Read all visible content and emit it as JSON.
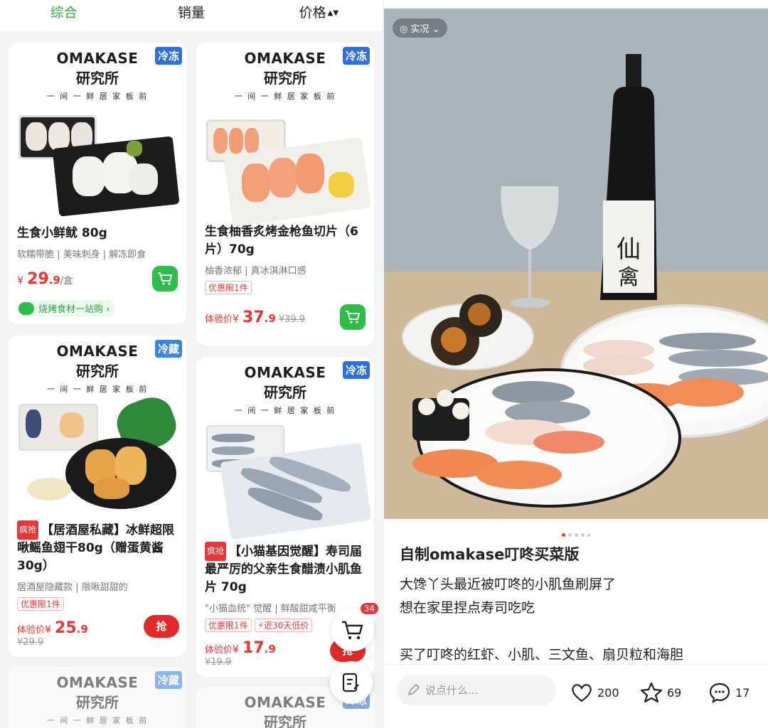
{
  "sort_bar": {
    "tabs": [
      "综合",
      "销量",
      "价格"
    ],
    "sort_icon": "sort-updown-icon"
  },
  "products": [
    {
      "brand_en": "OMAKASE",
      "brand_cn": "研究所",
      "brand_sub": "一 间 一 鲜   居 家 板 前",
      "temp_badge": "冷冻",
      "title": "生食小鲜鱿 80g",
      "desc": "软糯带脆 | 美味刺身 | 解冻即食",
      "price_cur": "¥",
      "price_int": "29",
      "price_dec": ".9",
      "price_unit": "/盒",
      "promo": "烧烤食材一站购 ›"
    },
    {
      "brand_en": "OMAKASE",
      "brand_cn": "研究所",
      "brand_sub": "一 间 一 鲜   居 家 板 前",
      "temp_badge": "冷冻",
      "title": "生食柚香炙烤金枪鱼切片（6片）70g",
      "desc": "柚香浓郁 | 真冰淇淋口感",
      "limit": "优惠限1件",
      "price_label": "体验价",
      "price_cur": "¥",
      "price_int": "37",
      "price_dec": ".9",
      "price_old": "¥39.9"
    },
    {
      "brand_en": "OMAKASE",
      "brand_cn": "研究所",
      "brand_sub": "一 间 一 鲜   居 家 板 前",
      "temp_badge": "冷藏",
      "hot": "疯抢",
      "title": "【居酒屋私藏】冰鲜超限啾鳐鱼翅干80g（赠蛋黄酱30g）",
      "desc": "居酒屋隐藏款 | 限啾甜甜的",
      "limit": "优惠限1件",
      "price_label": "体验价",
      "price_cur": "¥",
      "price_int": "25",
      "price_dec": ".9",
      "price_old": "¥29.9",
      "grab": "抢"
    },
    {
      "brand_en": "OMAKASE",
      "brand_cn": "研究所",
      "brand_sub": "一 间 一 鲜   居 家 板 前",
      "temp_badge": "冷冻",
      "hot": "疯抢",
      "title": "【小猫基因觉醒】寿司届最严厉的父亲生食醋渍小肌鱼片 70g",
      "desc": "\"小猫血统\" 觉醒 | 鲜酸甜咸平衡",
      "limit": "优惠限1件",
      "limit2": "⚡近30天低价",
      "price_label": "体验价",
      "price_cur": "¥",
      "price_int": "17",
      "price_dec": ".9",
      "price_old": "¥19.9",
      "grab": "抢"
    },
    {
      "brand_en": "OMAKASE",
      "brand_cn": "研究所",
      "brand_sub": "一 间 一 鲜   居 家 板 前",
      "temp_badge": "冷藏"
    },
    {
      "brand_en": "OMAKASE",
      "brand_cn": "研究所",
      "temp_badge": "冷冻"
    }
  ],
  "floating": {
    "cart_count": "34"
  },
  "post": {
    "live_tag": "实况",
    "title": "自制omakase叮咚买菜版",
    "body_lines": [
      "大馋丫头最近被叮咚的小肌鱼刷屏了",
      "想在家里捏点寿司吃吃",
      "",
      "买了叮咚的红虾、小肌、三文鱼、扇贝粒和海胆"
    ],
    "comment_placeholder": "说点什么...",
    "likes": "200",
    "stars": "69",
    "comments": "17"
  },
  "colors": {
    "accent_green": "#2fae3c",
    "price_red": "#e33333",
    "badge_blue": "#2e6fd8"
  }
}
